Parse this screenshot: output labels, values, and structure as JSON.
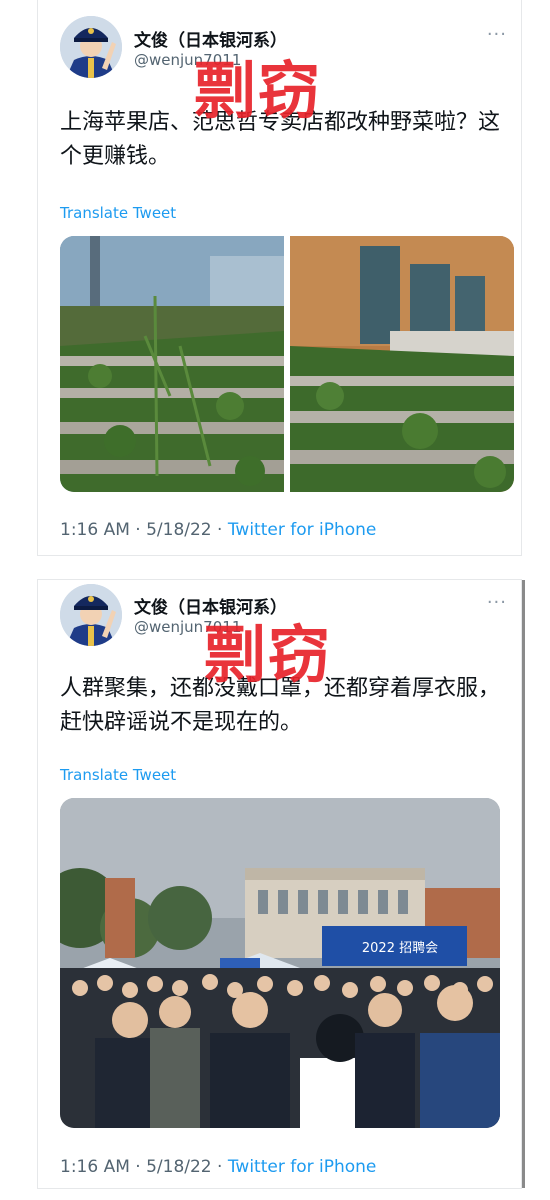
{
  "tweets": [
    {
      "name": "文俊（日本银河系）",
      "handle": "@wenjun7011",
      "more": "···",
      "stamp": "剽窃",
      "text": "上海苹果店、范思哲专卖店都改种野菜啦？这个更赚钱。",
      "translate": "Translate Tweet",
      "time": "1:16 AM · 5/18/22 · ",
      "app": "Twitter for iPhone",
      "media_type": "two-photo-grid"
    },
    {
      "name": "文俊（日本银河系）",
      "handle": "@wenjun7011",
      "more": "···",
      "stamp": "剽窃",
      "text": "人群聚集，还都没戴口罩，还都穿着厚衣服，赶快辟谣说不是现在的。",
      "translate": "Translate Tweet",
      "time": "1:16 AM · 5/18/22 · ",
      "app": "Twitter for iPhone",
      "media_type": "single-photo",
      "banner_text": "2022 招聘会"
    }
  ],
  "colors": {
    "link": "#1d9bf0",
    "stamp": "#e8232b",
    "secondary_text": "#536471"
  }
}
